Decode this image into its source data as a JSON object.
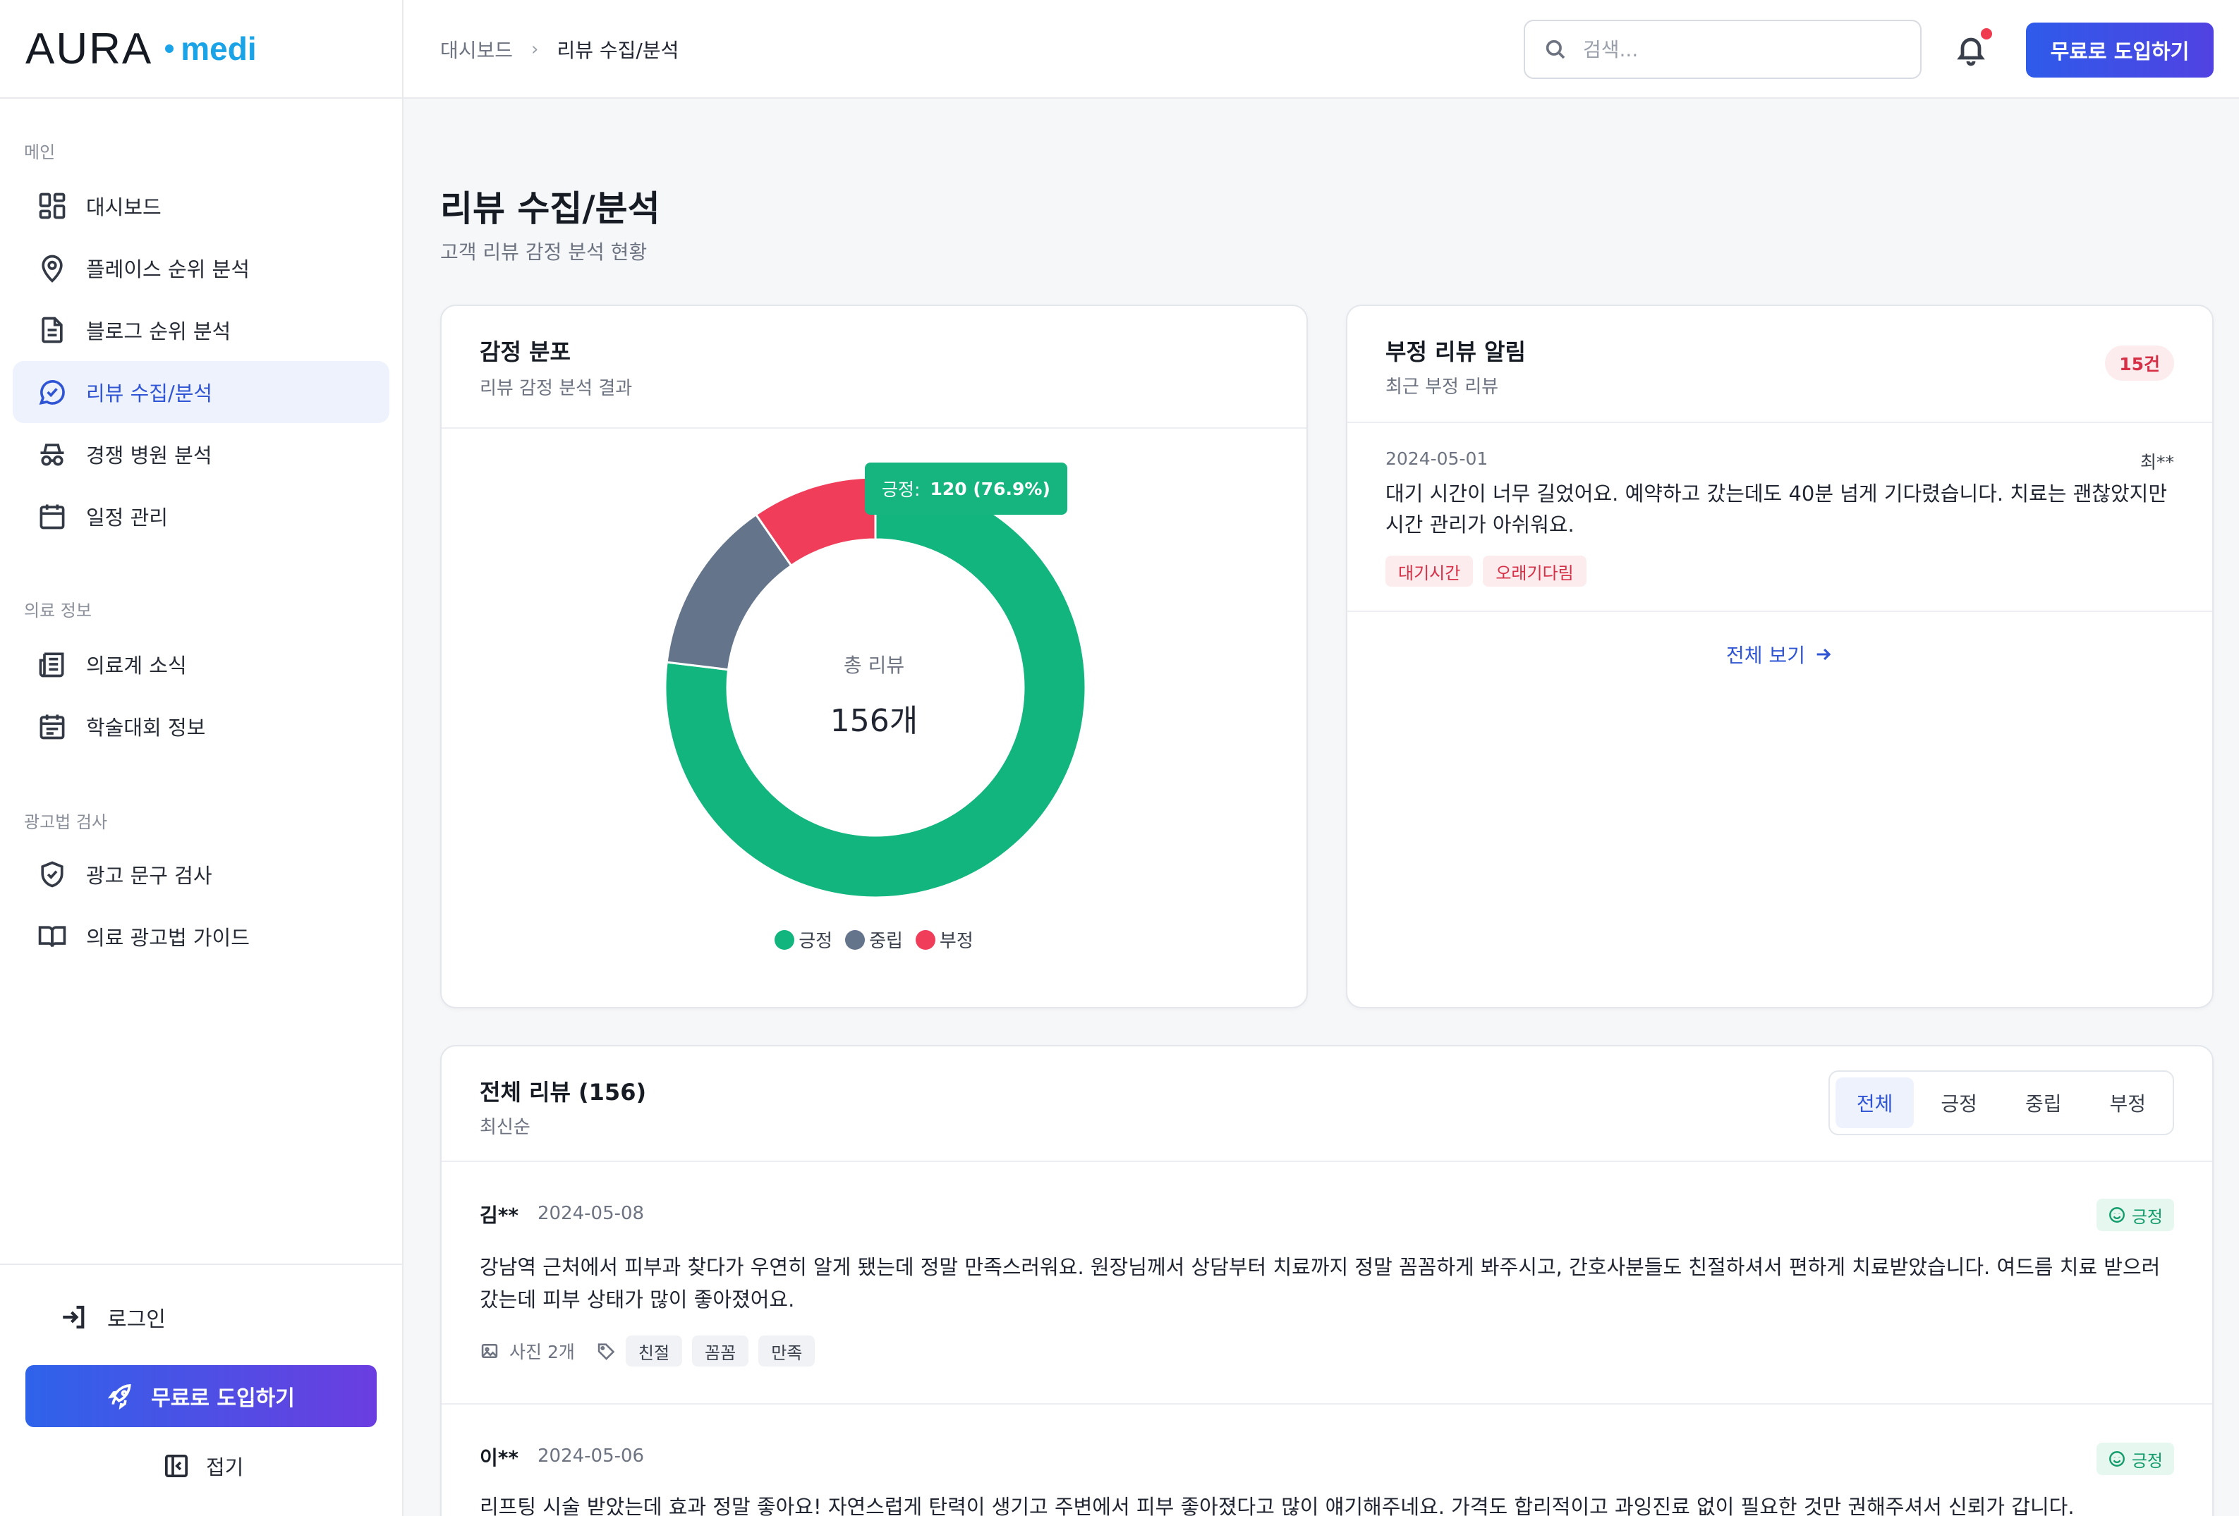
{
  "brand": {
    "name": "AURA",
    "sub": "medi"
  },
  "sidebar": {
    "sections": [
      {
        "label": "메인"
      },
      {
        "label": "의료 정보"
      },
      {
        "label": "광고법 검사"
      }
    ],
    "items": [
      {
        "label": "대시보드",
        "icon": "grid-icon"
      },
      {
        "label": "플레이스 순위 분석",
        "icon": "map-pin-icon"
      },
      {
        "label": "블로그 순위 분석",
        "icon": "document-icon"
      },
      {
        "label": "리뷰 수집/분석",
        "icon": "chat-check-icon",
        "active": true
      },
      {
        "label": "경쟁 병원 분석",
        "icon": "spy-icon"
      },
      {
        "label": "일정 관리",
        "icon": "calendar-icon"
      },
      {
        "label": "의료계 소식",
        "icon": "newspaper-icon"
      },
      {
        "label": "학술대회 정보",
        "icon": "calendar-list-icon"
      },
      {
        "label": "광고 문구 검사",
        "icon": "shield-check-icon"
      },
      {
        "label": "의료 광고법 가이드",
        "icon": "book-icon"
      }
    ],
    "login_label": "로그인",
    "cta_label": "무료로 도입하기",
    "collapse_label": "접기"
  },
  "header": {
    "breadcrumb_home": "대시보드",
    "breadcrumb_current": "리뷰 수집/분석",
    "search_placeholder": "검색...",
    "cta_label": "무료로 도입하기"
  },
  "page": {
    "title": "리뷰 수집/분석",
    "subtitle": "고객 리뷰 감정 분석 현황"
  },
  "sentiment_card": {
    "title": "감정 분포",
    "subtitle": "리뷰 감정 분석 결과",
    "center_label": "총 리뷰",
    "center_value": "156개",
    "tooltip_label": "긍정:",
    "tooltip_value": "120 (76.9%)"
  },
  "chart_data": {
    "type": "pie",
    "categories": [
      "긍정",
      "중립",
      "부정"
    ],
    "values": [
      120,
      21,
      15
    ],
    "colors": [
      "#12b57e",
      "#64748b",
      "#ef3d5a"
    ],
    "legend": "bottom"
  },
  "negative_card": {
    "title": "부정 리뷰 알림",
    "subtitle": "최근 부정 리뷰",
    "count": "15건",
    "review": {
      "date": "2024-05-01",
      "author": "최**",
      "text": "대기 시간이 너무 길었어요. 예약하고 갔는데도 40분 넘게 기다렸습니다. 치료는 괜찮았지만 시간 관리가 아쉬워요.",
      "tags": [
        "대기시간",
        "오래기다림"
      ]
    },
    "see_all": "전체 보기"
  },
  "reviews_card": {
    "title": "전체 리뷰 (156)",
    "subtitle": "최신순",
    "filters": [
      "전체",
      "긍정",
      "중립",
      "부정"
    ],
    "reviews": [
      {
        "author": "김**",
        "date": "2024-05-08",
        "sentiment": "긍정",
        "text": "강남역 근처에서 피부과 찾다가 우연히 알게 됐는데 정말 만족스러워요. 원장님께서 상담부터 치료까지 정말 꼼꼼하게 봐주시고, 간호사분들도 친절하셔서 편하게 치료받았습니다. 여드름 치료 받으러 갔는데 피부 상태가 많이 좋아졌어요.",
        "photos": "사진 2개",
        "tags": [
          "친절",
          "꼼꼼",
          "만족"
        ]
      },
      {
        "author": "이**",
        "date": "2024-05-06",
        "sentiment": "긍정",
        "text": "리프팅 시술 받았는데 효과 정말 좋아요! 자연스럽게 탄력이 생기고 주변에서 피부 좋아졌다고 많이 얘기해주네요. 가격도 합리적이고 과잉진료 없이 필요한 것만 권해주셔서 신뢰가 갑니다."
      }
    ]
  }
}
